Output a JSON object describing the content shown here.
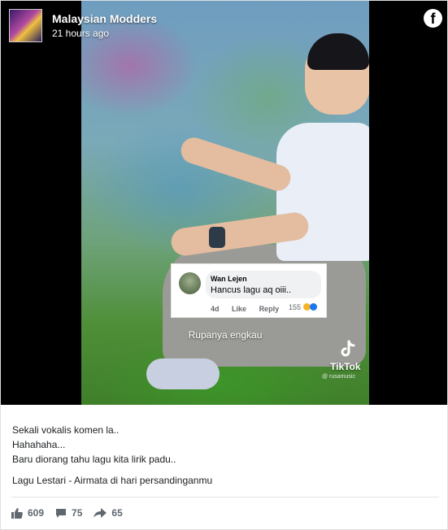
{
  "post": {
    "page_name": "Malaysian Modders",
    "time": "21 hours ago",
    "facebook_icon": "facebook-f-icon"
  },
  "video": {
    "comment": {
      "name": "Wan Lejen",
      "text": "Hancus lagu aq oiii..",
      "time": "4d",
      "like_label": "Like",
      "reply_label": "Reply",
      "reaction_count": "155"
    },
    "caption": "Rupanya engkau",
    "tiktok_brand": "TikTok",
    "tiktok_username": "@ rusamusic"
  },
  "message": {
    "lines": [
      "Sekali vokalis komen la..",
      "Hahahaha...",
      "Baru diorang tahu lagu kita lirik padu.."
    ],
    "song": "Lagu Lestari - Airmata di hari persandinganmu"
  },
  "stats": {
    "likes": "609",
    "comments": "75",
    "shares": "65"
  },
  "colors": {
    "brand": "#1877f2",
    "text": "#1c1e21",
    "muted": "#606770"
  }
}
